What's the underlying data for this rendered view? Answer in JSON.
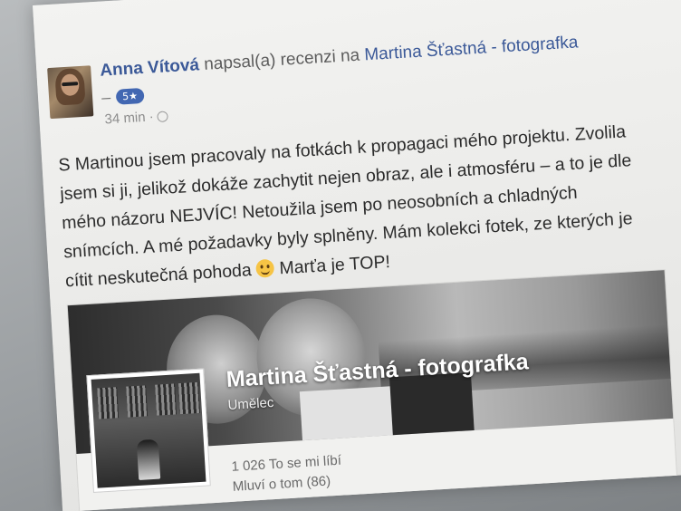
{
  "post": {
    "author": "Anna Vítová",
    "action_text": "napsal(a) recenzi na",
    "page_link": "Martina Šťastná - fotografka",
    "rating_dash": "–",
    "rating_badge": "5★",
    "time": "34 min ·",
    "body_line1": "S Martinou jsem pracovaly na fotkách k propagaci mého projektu. Zvolila",
    "body_line2": "jsem si ji, jelikož dokáže zachytit nejen obraz, ale i atmosféru – a to je dle",
    "body_line3": "mého názoru NEJVÍC! Netoužila jsem po neosobních a chladných",
    "body_line4": "snímcích. A mé požadavky byly splněny. Mám kolekci fotek, ze kterých je",
    "body_line5_start": "cítit neskutečná pohoda",
    "body_line5_end": "Marťa je TOP!"
  },
  "page_card": {
    "name": "Martina Šťastná - fotografka",
    "category": "Umělec",
    "likes": "1 026 To se mi líbí",
    "talking": "Mluví o tom (86)"
  },
  "icons": {
    "chevron": "chevron-down-icon",
    "globe": "globe-icon",
    "smiley": "smiley-icon"
  },
  "colors": {
    "link": "#3b5998",
    "badge": "#4267b2"
  }
}
